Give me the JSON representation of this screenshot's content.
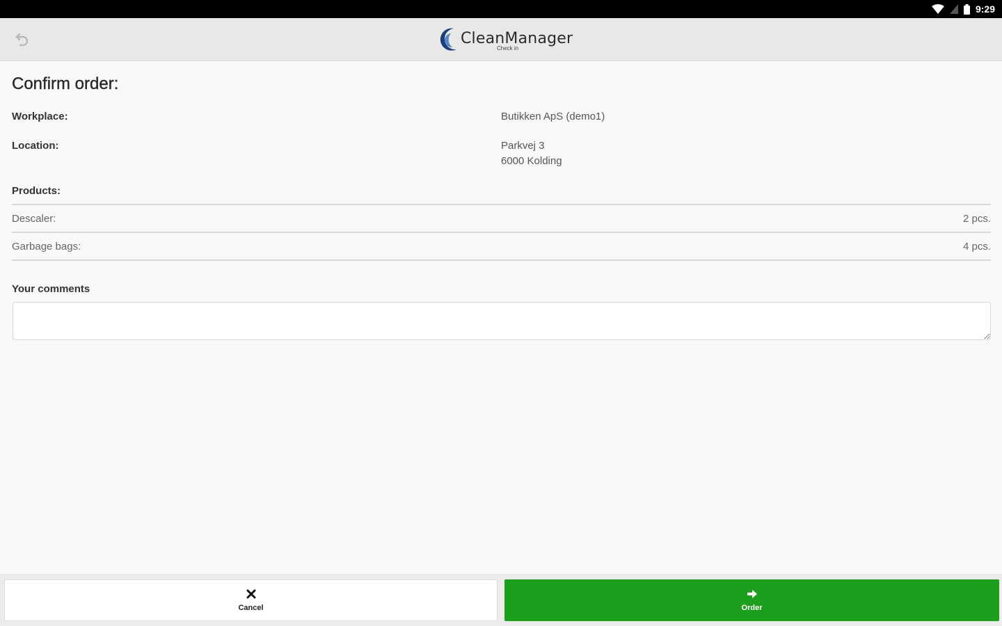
{
  "status_bar": {
    "time": "9:29",
    "icons": [
      "wifi-icon",
      "signal-icon",
      "battery-icon"
    ]
  },
  "app_bar": {
    "back_icon": "undo-arrow-icon",
    "logo_text": "CleanManager",
    "logo_subtext": "Check in",
    "logo_color": "#1e3f7a"
  },
  "page": {
    "title": "Confirm order:",
    "workplace_label": "Workplace:",
    "workplace_value": "Butikken ApS (demo1)",
    "location_label": "Location:",
    "location_line1": "Parkvej 3",
    "location_line2": "6000 Kolding",
    "products_label": "Products:",
    "products": [
      {
        "name": "Descaler:",
        "qty": "2 pcs."
      },
      {
        "name": "Garbage bags:",
        "qty": "4 pcs."
      }
    ],
    "comments_label": "Your comments",
    "comments_value": "",
    "comments_placeholder": ""
  },
  "actions": {
    "cancel_label": "Cancel",
    "cancel_icon": "close-icon",
    "order_label": "Order",
    "order_icon": "arrow-right-icon",
    "order_color": "#1e9e1e"
  }
}
